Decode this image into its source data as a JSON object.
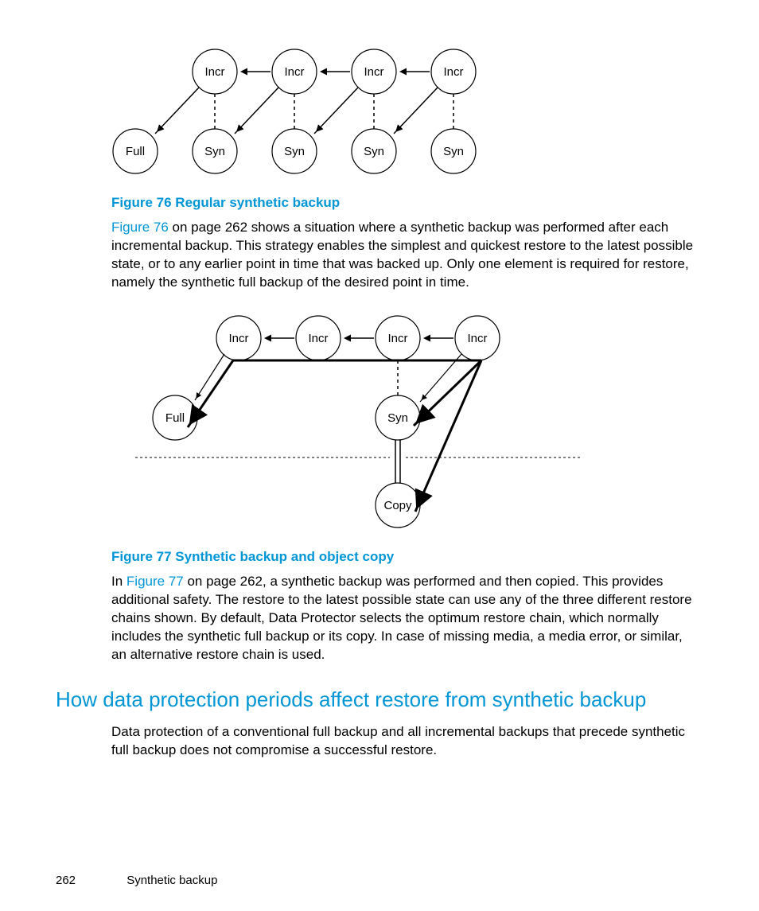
{
  "diagram1": {
    "nodes": {
      "incr": "Incr",
      "full": "Full",
      "syn": "Syn"
    }
  },
  "fig76": {
    "caption": "Figure 76 Regular synthetic backup",
    "link": "Figure 76",
    "text_after_link": " on page 262 shows a situation where a synthetic backup was performed after each incremental backup. This strategy enables the simplest and quickest restore to the latest possible state, or to any earlier point in time that was backed up. Only one element is required for restore, namely the synthetic full backup of the desired point in time."
  },
  "diagram2": {
    "nodes": {
      "incr": "Incr",
      "full": "Full",
      "syn": "Syn",
      "copy": "Copy"
    }
  },
  "fig77": {
    "caption": "Figure 77 Synthetic backup and object copy",
    "text_before_link": "In ",
    "link": "Figure 77",
    "text_after_link": " on page 262, a synthetic backup was performed and then copied. This provides additional safety. The restore to the latest possible state can use any of the three different restore chains shown. By default, Data Protector selects the optimum restore chain, which normally includes the synthetic full backup or its copy. In case of missing media, a media error, or similar, an alternative restore chain is used."
  },
  "section_heading": "How data protection periods affect restore from synthetic backup",
  "section_para": "Data protection of a conventional full backup and all incremental backups that precede synthetic full backup does not compromise a successful restore.",
  "footer": {
    "page": "262",
    "title": "Synthetic backup"
  }
}
